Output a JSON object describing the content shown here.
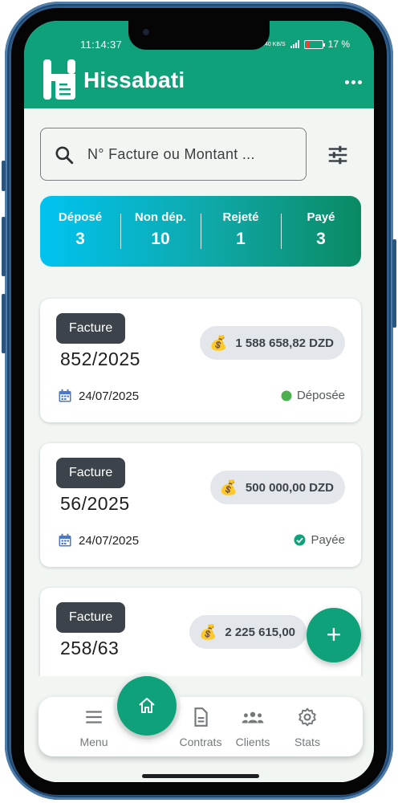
{
  "status_bar": {
    "time": "11:14:37",
    "net_speed": "4.40 KB/S",
    "battery": "17 %"
  },
  "app": {
    "name": "Hissabati"
  },
  "search": {
    "placeholder": "N° Facture ou Montant ..."
  },
  "stats": [
    {
      "label": "Déposé",
      "value": "3"
    },
    {
      "label": "Non dép.",
      "value": "10"
    },
    {
      "label": "Rejeté",
      "value": "1"
    },
    {
      "label": "Payé",
      "value": "3"
    }
  ],
  "invoices": [
    {
      "type": "Facture",
      "number": "852/2025",
      "amount": "1 588 658,82 DZD",
      "date": "24/07/2025",
      "status": "Déposée",
      "status_color": "#4caf50"
    },
    {
      "type": "Facture",
      "number": "56/2025",
      "amount": "500 000,00 DZD",
      "date": "24/07/2025",
      "status": "Payée",
      "status_color": "#0fa27a"
    },
    {
      "type": "Facture",
      "number": "258/63",
      "amount": "2 225 615,00",
      "date": "",
      "status": ""
    }
  ],
  "nav": {
    "menu": "Menu",
    "contracts": "Contrats",
    "clients": "Clients",
    "stats": "Stats"
  },
  "fab": {
    "label": "+"
  },
  "colors": {
    "primary": "#0fa27a",
    "card_bg": "#ffffff",
    "screen_bg": "#f1f6f3",
    "badge_bg": "#3d434a"
  },
  "icons": {
    "search": "search-icon",
    "filter": "tune-icon",
    "more": "more-horizontal-icon",
    "calendar": "calendar-icon",
    "money": "money-bag-icon",
    "home": "home-icon"
  }
}
